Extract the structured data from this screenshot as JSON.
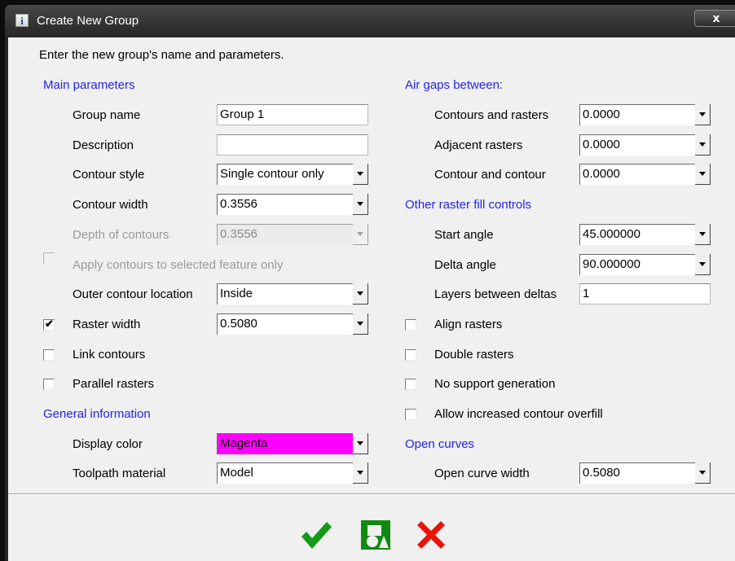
{
  "window": {
    "title": "Create New Group",
    "info_glyph": "i",
    "close_glyph": "x"
  },
  "prompt": "Enter the new group's name and parameters.",
  "main": {
    "heading": "Main parameters",
    "group_name": {
      "label": "Group name",
      "value": "Group 1"
    },
    "description": {
      "label": "Description",
      "value": ""
    },
    "contour_style": {
      "label": "Contour style",
      "value": "Single contour only"
    },
    "contour_width": {
      "label": "Contour width",
      "value": "0.3556"
    },
    "depth_of_contours": {
      "label": "Depth of contours",
      "value": "0.3556"
    },
    "apply_contours": {
      "label": "Apply contours to selected feature only",
      "checked": false
    },
    "outer_contour_location": {
      "label": "Outer contour location",
      "value": "Inside"
    },
    "raster_width": {
      "label": "Raster width",
      "value": "0.5080",
      "checked": true
    },
    "link_contours": {
      "label": "Link contours",
      "checked": false
    },
    "parallel_rasters": {
      "label": "Parallel rasters",
      "checked": false
    }
  },
  "general": {
    "heading": "General information",
    "display_color": {
      "label": "Display color",
      "value": "Magenta",
      "swatch": "#ff00ff"
    },
    "toolpath_material": {
      "label": "Toolpath material",
      "value": "Model"
    }
  },
  "air_gaps": {
    "heading": "Air gaps between:",
    "contours_and_rasters": {
      "label": "Contours and rasters",
      "value": "0.0000"
    },
    "adjacent_rasters": {
      "label": "Adjacent rasters",
      "value": "0.0000"
    },
    "contour_and_contour": {
      "label": "Contour and contour",
      "value": "0.0000"
    }
  },
  "raster_fill": {
    "heading": "Other raster fill controls",
    "start_angle": {
      "label": "Start angle",
      "value": "45.000000"
    },
    "delta_angle": {
      "label": "Delta angle",
      "value": "90.000000"
    },
    "layers_between_deltas": {
      "label": "Layers between deltas",
      "value": "1"
    },
    "align_rasters": {
      "label": "Align rasters",
      "checked": false
    },
    "double_rasters": {
      "label": "Double rasters",
      "checked": false
    },
    "no_support_generation": {
      "label": "No support generation",
      "checked": false
    },
    "allow_increased_overfill": {
      "label": "Allow increased contour overfill",
      "checked": false
    }
  },
  "open_curves": {
    "heading": "Open curves",
    "open_curve_width": {
      "label": "Open curve width",
      "value": "0.5080"
    }
  },
  "buttons": {
    "ok_icon": "checkmark-icon",
    "preview_icon": "preview-icon",
    "cancel_icon": "cancel-x-icon"
  },
  "colors": {
    "section_heading": "#2323e8",
    "ok_green": "#159a15",
    "cancel_red": "#e8140a",
    "preview_green": "#0f8a0f"
  }
}
